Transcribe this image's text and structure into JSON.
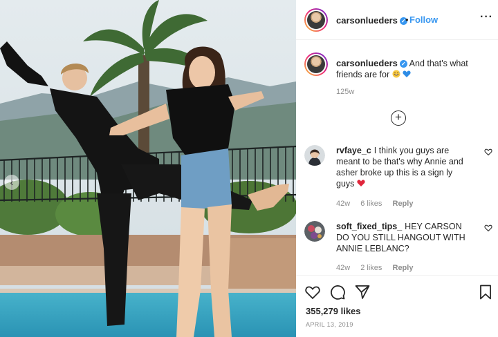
{
  "post": {
    "author": "carsonlueders",
    "follow_label": "Follow",
    "separator": "•",
    "more_label": "···",
    "caption": {
      "username": "carsonlueders",
      "text": "And that's what friends are for",
      "emoji": [
        "grin-sweat-emoji",
        "blue-heart-emoji"
      ],
      "age": "125w"
    },
    "load_more_label": "+"
  },
  "comments": [
    {
      "username": "rvfaye_c",
      "text": "I think you guys are meant to be that's why Annie and asher broke up this is a sign ly guys",
      "emoji": "red-heart-emoji",
      "age": "42w",
      "likes": "6 likes",
      "reply_label": "Reply"
    },
    {
      "username": "soft_fixed_tips_",
      "text": "HEY CARSON DO YOU STILL HANGOUT WITH ANNIE LEBLANC?",
      "age": "42w",
      "likes": "2 likes",
      "reply_label": "Reply"
    }
  ],
  "footer": {
    "likes": "355,279 likes",
    "date": "APRIL 13, 2019"
  },
  "colors": {
    "link_blue": "#3897f0",
    "meta_gray": "#8e8e8e",
    "text": "#262626"
  }
}
